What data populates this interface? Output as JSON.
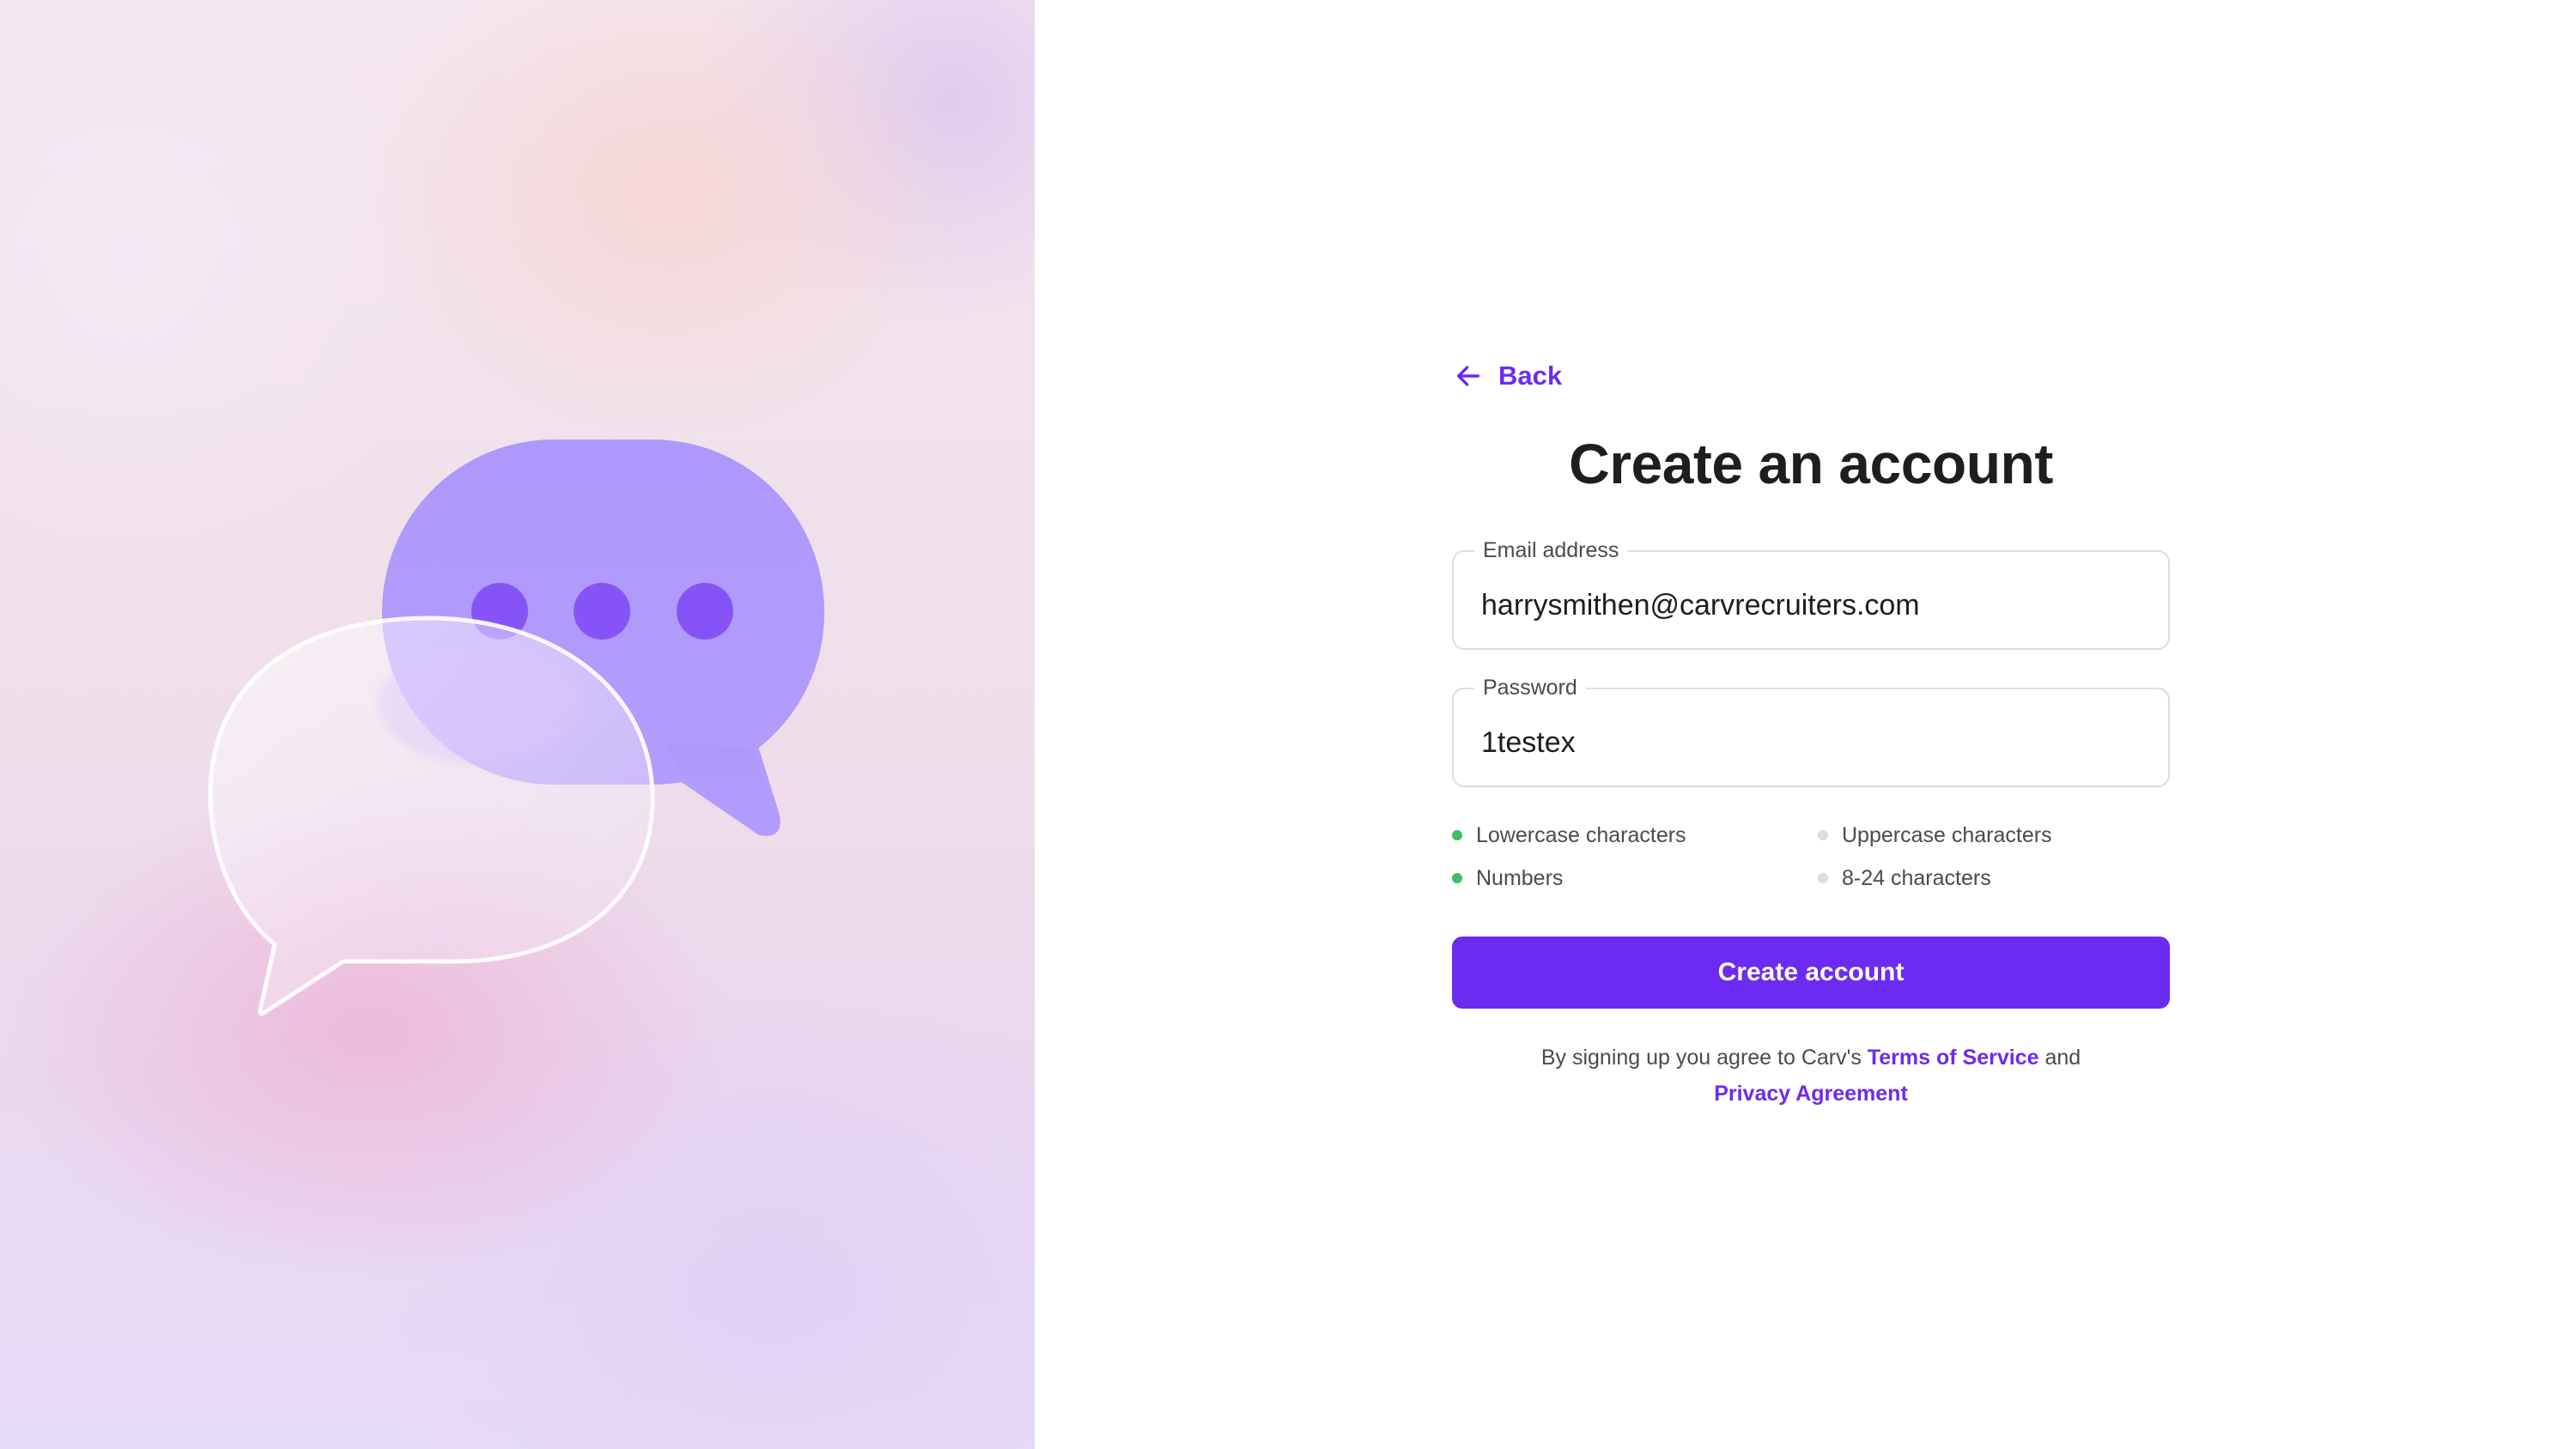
{
  "colors": {
    "accent": "#6c2bf0",
    "rule_met": "#3bbf63",
    "rule_unmet": "#dcdce1"
  },
  "illustration": {
    "icon": "chat-bubbles-icon"
  },
  "header": {
    "back_label": "Back",
    "back_icon": "arrow-left-icon",
    "title": "Create an account"
  },
  "form": {
    "email": {
      "label": "Email address",
      "value": "harrysmithen@carvrecruiters.com"
    },
    "password": {
      "label": "Password",
      "value": "1testex"
    },
    "rules": [
      {
        "label": "Lowercase characters",
        "met": true
      },
      {
        "label": "Uppercase characters",
        "met": false
      },
      {
        "label": "Numbers",
        "met": true
      },
      {
        "label": "8-24 characters",
        "met": false
      }
    ],
    "submit_label": "Create account"
  },
  "legal": {
    "prefix": "By signing up you agree to Carv's",
    "terms_label": "Terms of Service",
    "joiner": "and",
    "privacy_label": "Privacy Agreement"
  }
}
